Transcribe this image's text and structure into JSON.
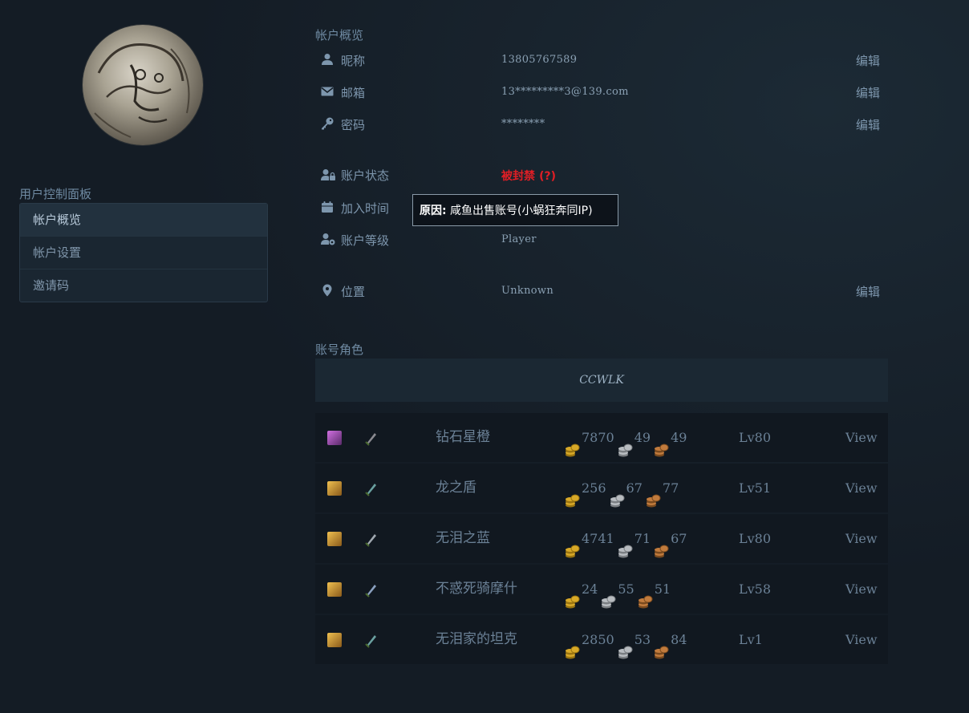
{
  "sidebar": {
    "title": "用户控制面板",
    "items": [
      {
        "label": "帐户概览"
      },
      {
        "label": "帐户设置"
      },
      {
        "label": "邀请码"
      }
    ]
  },
  "overview": {
    "title": "帐户概览",
    "rows": [
      {
        "icon": "user-icon",
        "label": "昵称",
        "value": "13805767589",
        "edit": "编辑"
      },
      {
        "icon": "envelope-icon",
        "label": "邮箱",
        "value": "13*********3@139.com",
        "edit": "编辑"
      },
      {
        "icon": "key-icon",
        "label": "密码",
        "value": "********",
        "edit": "编辑"
      }
    ],
    "status": {
      "label": "账户状态",
      "value": "被封禁",
      "help": "(?)"
    },
    "joined": {
      "label": "加入时间"
    },
    "level": {
      "label": "账户等级",
      "value": "Player"
    },
    "location": {
      "label": "位置",
      "value": "Unknown",
      "edit": "编辑"
    }
  },
  "tooltip": {
    "prefix": "原因:",
    "text": " 咸鱼出售账号(小蜗狂奔同IP)"
  },
  "characters": {
    "title": "账号角色",
    "realm": "CCWLK",
    "rows": [
      {
        "name": "钻石星橙",
        "gold": "7870",
        "silver": "49",
        "copper": "49",
        "level": "Lv80",
        "view": "View",
        "race_icon": "undead-female-icon",
        "class_icon": "warlock-icon"
      },
      {
        "name": "龙之盾",
        "gold": "256",
        "silver": "67",
        "copper": "77",
        "level": "Lv51",
        "view": "View",
        "race_icon": "human-female-icon",
        "class_icon": "warrior-icon"
      },
      {
        "name": "无泪之蓝",
        "gold": "4741",
        "silver": "71",
        "copper": "67",
        "level": "Lv80",
        "view": "View",
        "race_icon": "human-female-icon",
        "class_icon": "rogue-icon"
      },
      {
        "name": "不惑死骑摩什",
        "gold": "24",
        "silver": "55",
        "copper": "51",
        "level": "Lv58",
        "view": "View",
        "race_icon": "human-female-icon",
        "class_icon": "death-knight-icon"
      },
      {
        "name": "无泪家的坦克",
        "gold": "2850",
        "silver": "53",
        "copper": "84",
        "level": "Lv1",
        "view": "View",
        "race_icon": "human-female-icon",
        "class_icon": "warrior-icon"
      }
    ]
  },
  "colors": {
    "accent": "#7d96ad",
    "banned": "#e01e25",
    "gold": "#d8a928",
    "silver": "#b8bcc0",
    "copper": "#c17b3d"
  }
}
